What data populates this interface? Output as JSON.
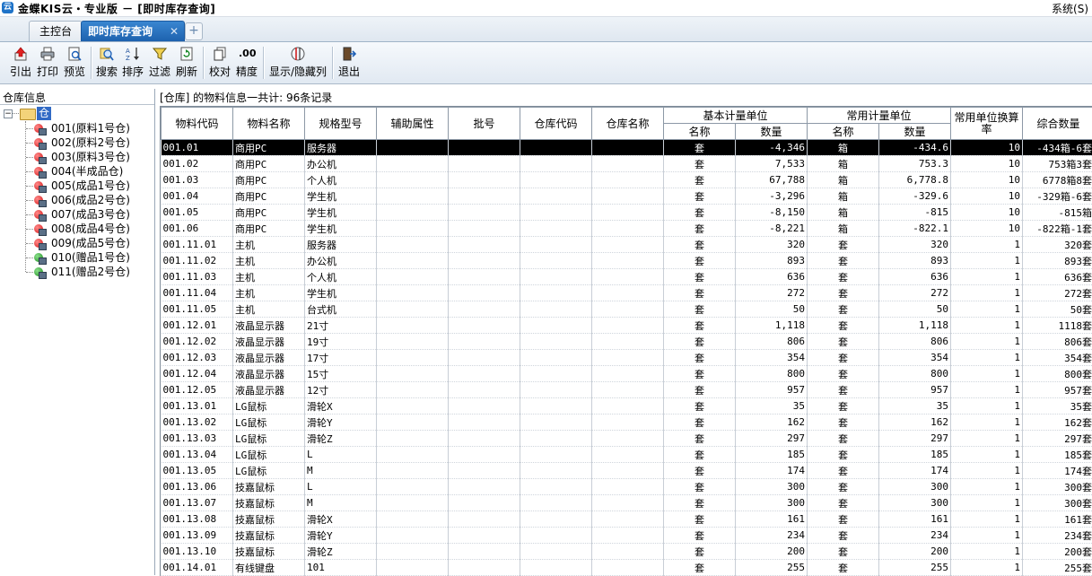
{
  "window": {
    "title": "金蝶KIS云・专业版 － [即时库存查询]",
    "system_menu": "系统(S)",
    "logo_glyph": "云"
  },
  "tabs": {
    "home": "主控台",
    "active": "即时库存查询",
    "close": "✕",
    "add": "+"
  },
  "toolbar": {
    "items": [
      "引出",
      "打印",
      "预览",
      "搜索",
      "排序",
      "过滤",
      "刷新",
      "校对",
      "精度",
      "显示/隐藏列",
      "退出"
    ],
    "precision_icon_text": ".00"
  },
  "left": {
    "title": "仓库信息",
    "root": "仓库",
    "items": [
      {
        "label": "001(原料1号仓)",
        "status": "red"
      },
      {
        "label": "002(原料2号仓)",
        "status": "red"
      },
      {
        "label": "003(原料3号仓)",
        "status": "red"
      },
      {
        "label": "004(半成品仓)",
        "status": "red"
      },
      {
        "label": "005(成品1号仓)",
        "status": "red"
      },
      {
        "label": "006(成品2号仓)",
        "status": "red"
      },
      {
        "label": "007(成品3号仓)",
        "status": "red"
      },
      {
        "label": "008(成品4号仓)",
        "status": "red"
      },
      {
        "label": "009(成品5号仓)",
        "status": "red"
      },
      {
        "label": "010(赠品1号仓)",
        "status": "green"
      },
      {
        "label": "011(赠品2号仓)",
        "status": "green"
      }
    ]
  },
  "main": {
    "info": "[仓库] 的物料信息一共计: 96条记录",
    "headers": {
      "code": "物料代码",
      "name": "物料名称",
      "spec": "规格型号",
      "aux": "辅助属性",
      "batch": "批号",
      "wh_code": "仓库代码",
      "wh_name": "仓库名称",
      "base_unit": "基本计量单位",
      "common_unit": "常用计量单位",
      "unit_name": "名称",
      "qty": "数量",
      "rate": "常用单位换算率",
      "combined": "综合数量"
    },
    "rows": [
      [
        "001.01",
        "商用PC",
        "服务器",
        "套",
        "-4,346",
        "箱",
        "-434.6",
        "10",
        "-434箱-6套"
      ],
      [
        "001.02",
        "商用PC",
        "办公机",
        "套",
        "7,533",
        "箱",
        "753.3",
        "10",
        "753箱3套"
      ],
      [
        "001.03",
        "商用PC",
        "个人机",
        "套",
        "67,788",
        "箱",
        "6,778.8",
        "10",
        "6778箱8套"
      ],
      [
        "001.04",
        "商用PC",
        "学生机",
        "套",
        "-3,296",
        "箱",
        "-329.6",
        "10",
        "-329箱-6套"
      ],
      [
        "001.05",
        "商用PC",
        "学生机",
        "套",
        "-8,150",
        "箱",
        "-815",
        "10",
        "-815箱"
      ],
      [
        "001.06",
        "商用PC",
        "学生机",
        "套",
        "-8,221",
        "箱",
        "-822.1",
        "10",
        "-822箱-1套"
      ],
      [
        "001.11.01",
        "主机",
        "服务器",
        "套",
        "320",
        "套",
        "320",
        "1",
        "320套"
      ],
      [
        "001.11.02",
        "主机",
        "办公机",
        "套",
        "893",
        "套",
        "893",
        "1",
        "893套"
      ],
      [
        "001.11.03",
        "主机",
        "个人机",
        "套",
        "636",
        "套",
        "636",
        "1",
        "636套"
      ],
      [
        "001.11.04",
        "主机",
        "学生机",
        "套",
        "272",
        "套",
        "272",
        "1",
        "272套"
      ],
      [
        "001.11.05",
        "主机",
        "台式机",
        "套",
        "50",
        "套",
        "50",
        "1",
        "50套"
      ],
      [
        "001.12.01",
        "液晶显示器",
        "21寸",
        "套",
        "1,118",
        "套",
        "1,118",
        "1",
        "1118套"
      ],
      [
        "001.12.02",
        "液晶显示器",
        "19寸",
        "套",
        "806",
        "套",
        "806",
        "1",
        "806套"
      ],
      [
        "001.12.03",
        "液晶显示器",
        "17寸",
        "套",
        "354",
        "套",
        "354",
        "1",
        "354套"
      ],
      [
        "001.12.04",
        "液晶显示器",
        "15寸",
        "套",
        "800",
        "套",
        "800",
        "1",
        "800套"
      ],
      [
        "001.12.05",
        "液晶显示器",
        "12寸",
        "套",
        "957",
        "套",
        "957",
        "1",
        "957套"
      ],
      [
        "001.13.01",
        "LG鼠标",
        "滑轮X",
        "套",
        "35",
        "套",
        "35",
        "1",
        "35套"
      ],
      [
        "001.13.02",
        "LG鼠标",
        "滑轮Y",
        "套",
        "162",
        "套",
        "162",
        "1",
        "162套"
      ],
      [
        "001.13.03",
        "LG鼠标",
        "滑轮Z",
        "套",
        "297",
        "套",
        "297",
        "1",
        "297套"
      ],
      [
        "001.13.04",
        "LG鼠标",
        "L",
        "套",
        "185",
        "套",
        "185",
        "1",
        "185套"
      ],
      [
        "001.13.05",
        "LG鼠标",
        "M",
        "套",
        "174",
        "套",
        "174",
        "1",
        "174套"
      ],
      [
        "001.13.06",
        "技嘉鼠标",
        "L",
        "套",
        "300",
        "套",
        "300",
        "1",
        "300套"
      ],
      [
        "001.13.07",
        "技嘉鼠标",
        "M",
        "套",
        "300",
        "套",
        "300",
        "1",
        "300套"
      ],
      [
        "001.13.08",
        "技嘉鼠标",
        "滑轮X",
        "套",
        "161",
        "套",
        "161",
        "1",
        "161套"
      ],
      [
        "001.13.09",
        "技嘉鼠标",
        "滑轮Y",
        "套",
        "234",
        "套",
        "234",
        "1",
        "234套"
      ],
      [
        "001.13.10",
        "技嘉鼠标",
        "滑轮Z",
        "套",
        "200",
        "套",
        "200",
        "1",
        "200套"
      ],
      [
        "001.14.01",
        "有线键盘",
        "101",
        "套",
        "255",
        "套",
        "255",
        "1",
        "255套"
      ]
    ]
  }
}
